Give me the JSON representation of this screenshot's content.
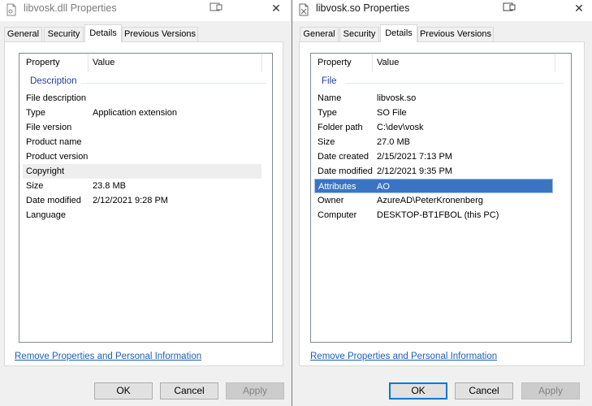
{
  "dialogs": [
    {
      "title": "libvosk.dll Properties",
      "icons": {
        "file": "file-icon",
        "help": "help-icon",
        "close": "close-icon"
      },
      "tabs": [
        "General",
        "Security",
        "Details",
        "Previous Versions"
      ],
      "active_tab": "Details",
      "columns": {
        "property": "Property",
        "value": "Value"
      },
      "group": "Description",
      "rows": [
        {
          "property": "File description",
          "value": ""
        },
        {
          "property": "Type",
          "value": "Application extension"
        },
        {
          "property": "File version",
          "value": ""
        },
        {
          "property": "Product name",
          "value": ""
        },
        {
          "property": "Product version",
          "value": ""
        },
        {
          "property": "Copyright",
          "value": "",
          "state": "hover"
        },
        {
          "property": "Size",
          "value": "23.8 MB"
        },
        {
          "property": "Date modified",
          "value": "2/12/2021 9:28 PM"
        },
        {
          "property": "Language",
          "value": ""
        }
      ],
      "link": "Remove Properties and Personal Information",
      "buttons": {
        "ok": "OK",
        "cancel": "Cancel",
        "apply": "Apply"
      }
    },
    {
      "title": "libvosk.so Properties",
      "icons": {
        "file": "file-icon",
        "help": "help-icon",
        "close": "close-icon"
      },
      "tabs": [
        "General",
        "Security",
        "Details",
        "Previous Versions"
      ],
      "active_tab": "Details",
      "columns": {
        "property": "Property",
        "value": "Value"
      },
      "group": "File",
      "rows": [
        {
          "property": "Name",
          "value": "libvosk.so"
        },
        {
          "property": "Type",
          "value": "SO File"
        },
        {
          "property": "Folder path",
          "value": "C:\\dev\\vosk"
        },
        {
          "property": "Size",
          "value": "27.0 MB"
        },
        {
          "property": "Date created",
          "value": "2/15/2021 7:13 PM"
        },
        {
          "property": "Date modified",
          "value": "2/12/2021 9:35 PM"
        },
        {
          "property": "Attributes",
          "value": "AO",
          "state": "selected"
        },
        {
          "property": "Owner",
          "value": "AzureAD\\PeterKronenberg"
        },
        {
          "property": "Computer",
          "value": "DESKTOP-BT1FBOL (this PC)"
        }
      ],
      "link": "Remove Properties and Personal Information",
      "buttons": {
        "ok": "OK",
        "cancel": "Cancel",
        "apply": "Apply"
      }
    }
  ],
  "colors": {
    "selection": "#3a75c4",
    "group_heading": "#1e3e9c",
    "link": "#1a5fb4",
    "default_button_border": "#0078d7"
  }
}
